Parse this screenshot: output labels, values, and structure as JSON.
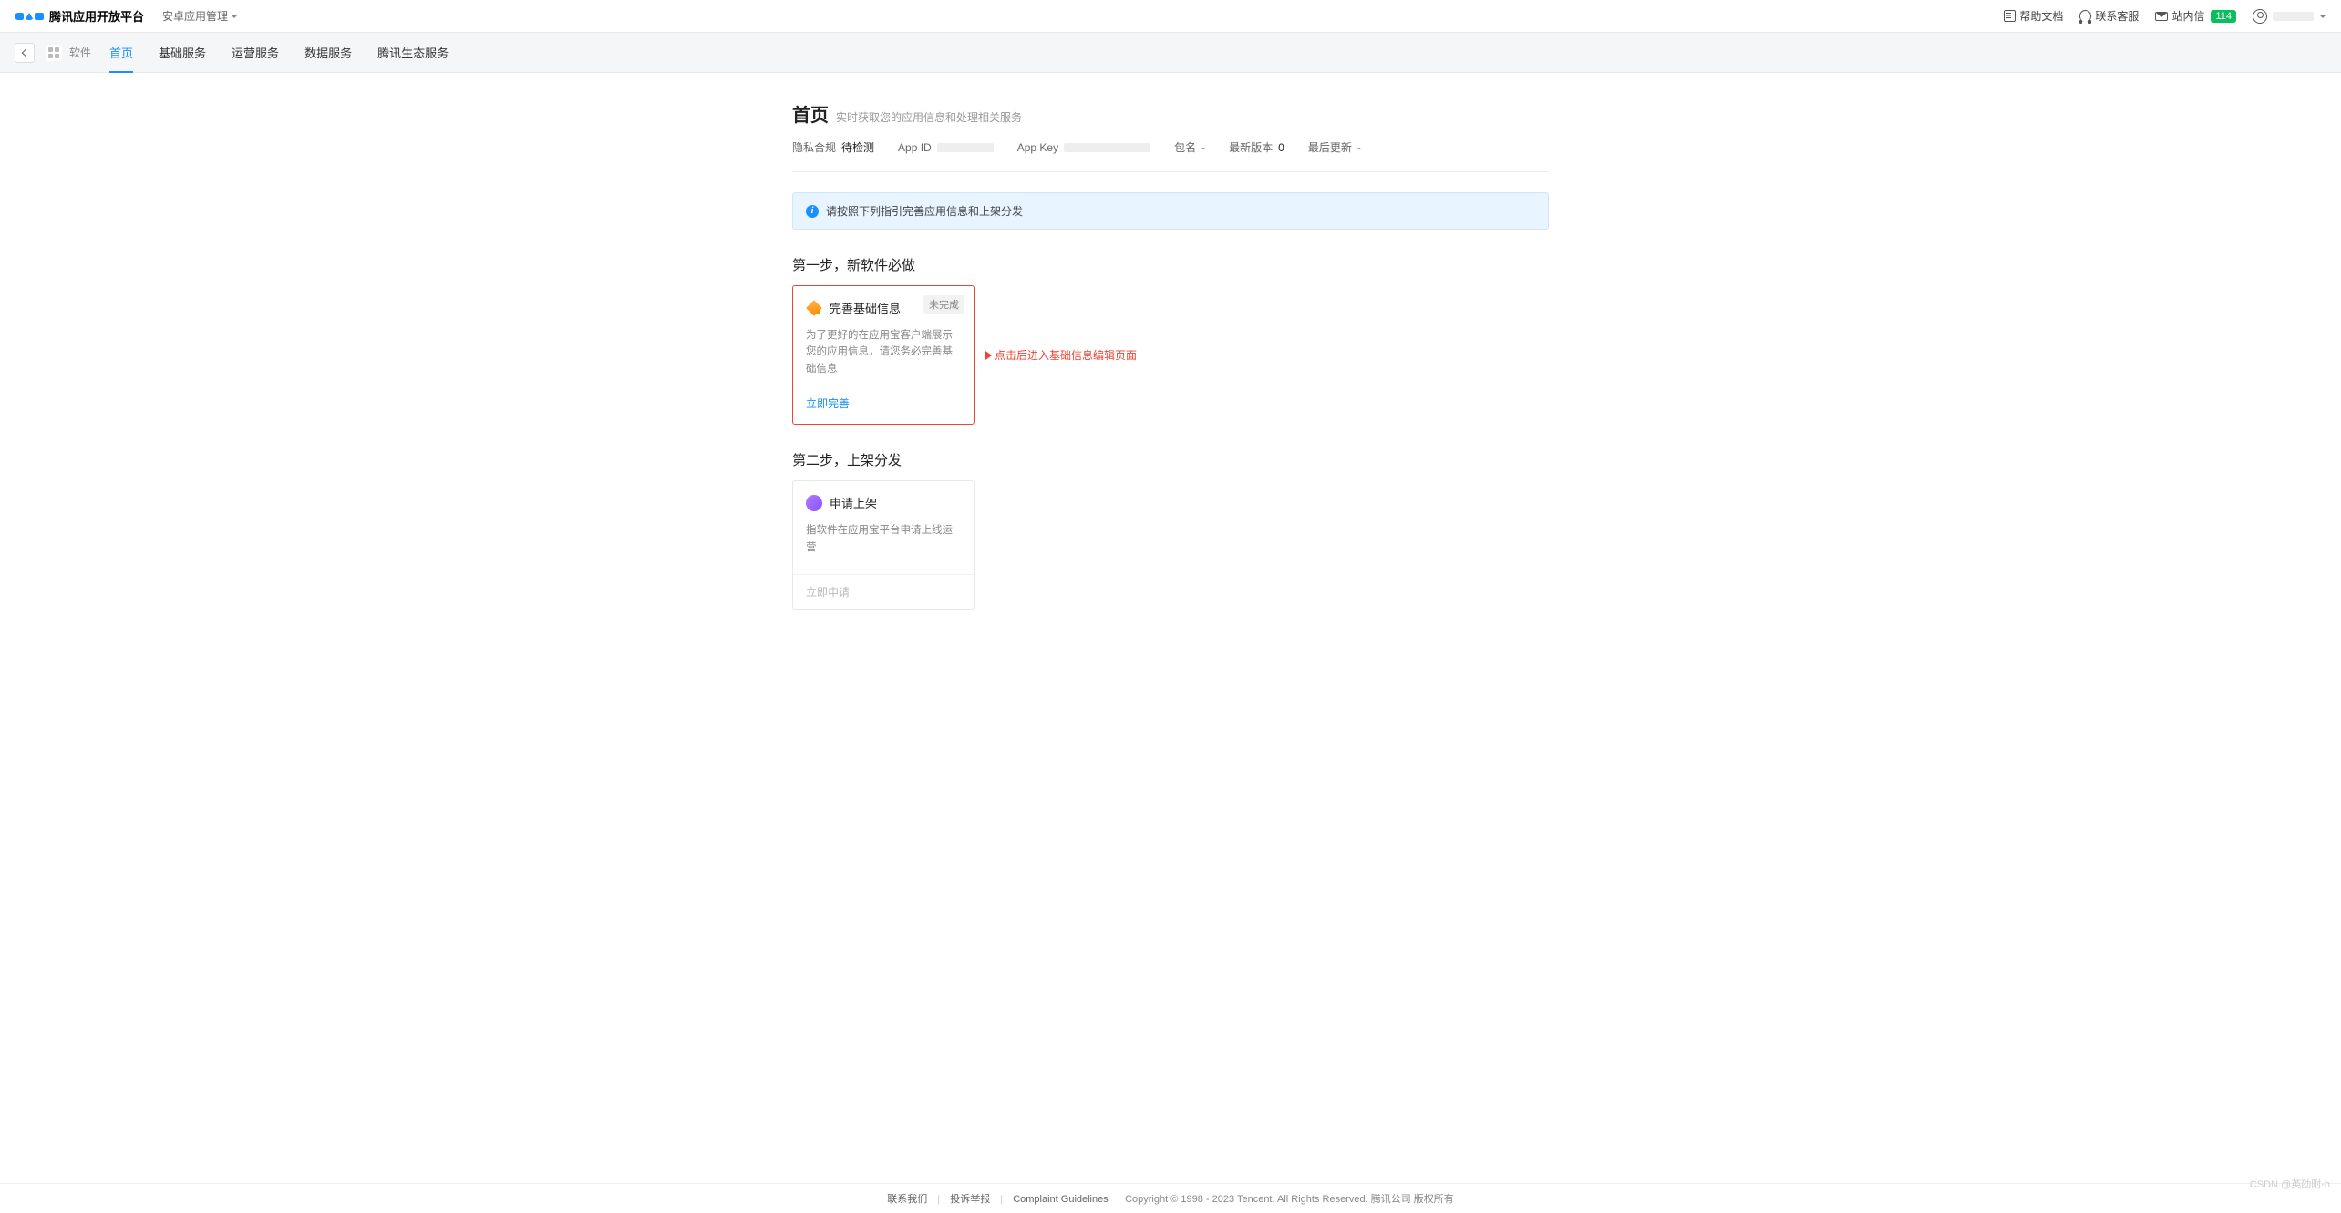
{
  "header": {
    "platform_name": "腾讯应用开放平台",
    "management_dropdown": "安卓应用管理",
    "links": {
      "help_docs": "帮助文档",
      "contact_cs": "联系客服",
      "inbox_label": "站内信",
      "inbox_count": "114"
    }
  },
  "nav": {
    "app_type": "软件",
    "tabs": [
      "首页",
      "基础服务",
      "运营服务",
      "数据服务",
      "腾讯生态服务"
    ],
    "active_index": 0
  },
  "page": {
    "title": "首页",
    "subtitle": "实时获取您的应用信息和处理相关服务"
  },
  "meta": {
    "privacy_label": "隐私合规",
    "privacy_value": "待检测",
    "appid_label": "App ID",
    "appkey_label": "App Key",
    "pkg_label": "包名",
    "pkg_value": "-",
    "latest_ver_label": "最新版本",
    "latest_ver_value": "0",
    "last_update_label": "最后更新",
    "last_update_value": "-"
  },
  "banner": "请按照下列指引完善应用信息和上架分发",
  "step1": {
    "title": "第一步，新软件必做",
    "card": {
      "name": "完善基础信息",
      "tag": "未完成",
      "desc": "为了更好的在应用宝客户端展示您的应用信息，请您务必完善基础信息",
      "action": "立即完善"
    },
    "annotation": "点击后进入基础信息编辑页面"
  },
  "step2": {
    "title": "第二步，上架分发",
    "card": {
      "name": "申请上架",
      "desc": "指软件在应用宝平台申请上线运营",
      "action": "立即申请"
    }
  },
  "footer": {
    "contact": "联系我们",
    "complain": "投诉举报",
    "guidelines": "Complaint Guidelines",
    "copyright": "Copyright © 1998 - 2023 Tencent. All Rights Reserved. 腾讯公司 版权所有"
  },
  "watermark": "CSDN @英劭附-h"
}
